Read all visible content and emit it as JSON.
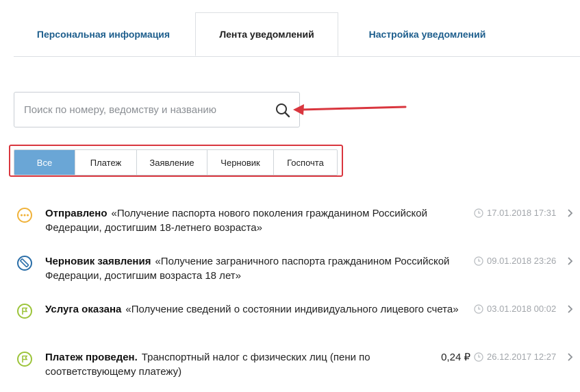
{
  "tabs": [
    {
      "label": "Персональная информация",
      "active": false
    },
    {
      "label": "Лента уведомлений",
      "active": true
    },
    {
      "label": "Настройка уведомлений",
      "active": false
    }
  ],
  "search": {
    "placeholder": "Поиск по номеру, ведомству и названию",
    "value": "",
    "icon": "search-icon"
  },
  "filters": [
    {
      "label": "Все",
      "active": true
    },
    {
      "label": "Платеж",
      "active": false
    },
    {
      "label": "Заявление",
      "active": false
    },
    {
      "label": "Черновик",
      "active": false
    },
    {
      "label": "Госпочта",
      "active": false
    }
  ],
  "feed": [
    {
      "status": "Отправлено",
      "title": "«Получение паспорта нового поколения гражданином Российской Федерации, достигшим 18-летнего возраста»",
      "amount": "",
      "date": "17.01.2018 17:31",
      "icon": "sent-dots-icon",
      "icon_color": "#f0b23a"
    },
    {
      "status": "Черновик заявления",
      "title": "«Получение заграничного паспорта гражданином Российской Федерации, достигшим возраста 18 лет»",
      "amount": "",
      "date": "09.01.2018 23:26",
      "icon": "draft-pencil-icon",
      "icon_color": "#2a6ea8"
    },
    {
      "status": "Услуга оказана",
      "title": "«Получение сведений о состоянии индивидуального лицевого счета»",
      "amount": "",
      "date": "03.01.2018 00:02",
      "icon": "flag-icon",
      "icon_color": "#9cc43a"
    },
    {
      "status": "Платеж проведен.",
      "title": "Транспортный налог с физических лиц (пени по соответствующему платежу)",
      "amount": "0,24 ₽",
      "date": "26.12.2017 12:27",
      "icon": "flag-icon",
      "icon_color": "#9cc43a"
    }
  ],
  "colors": {
    "accent": "#6aa6d6",
    "tab_text": "#1c5d8c",
    "highlight": "#d9363e"
  }
}
